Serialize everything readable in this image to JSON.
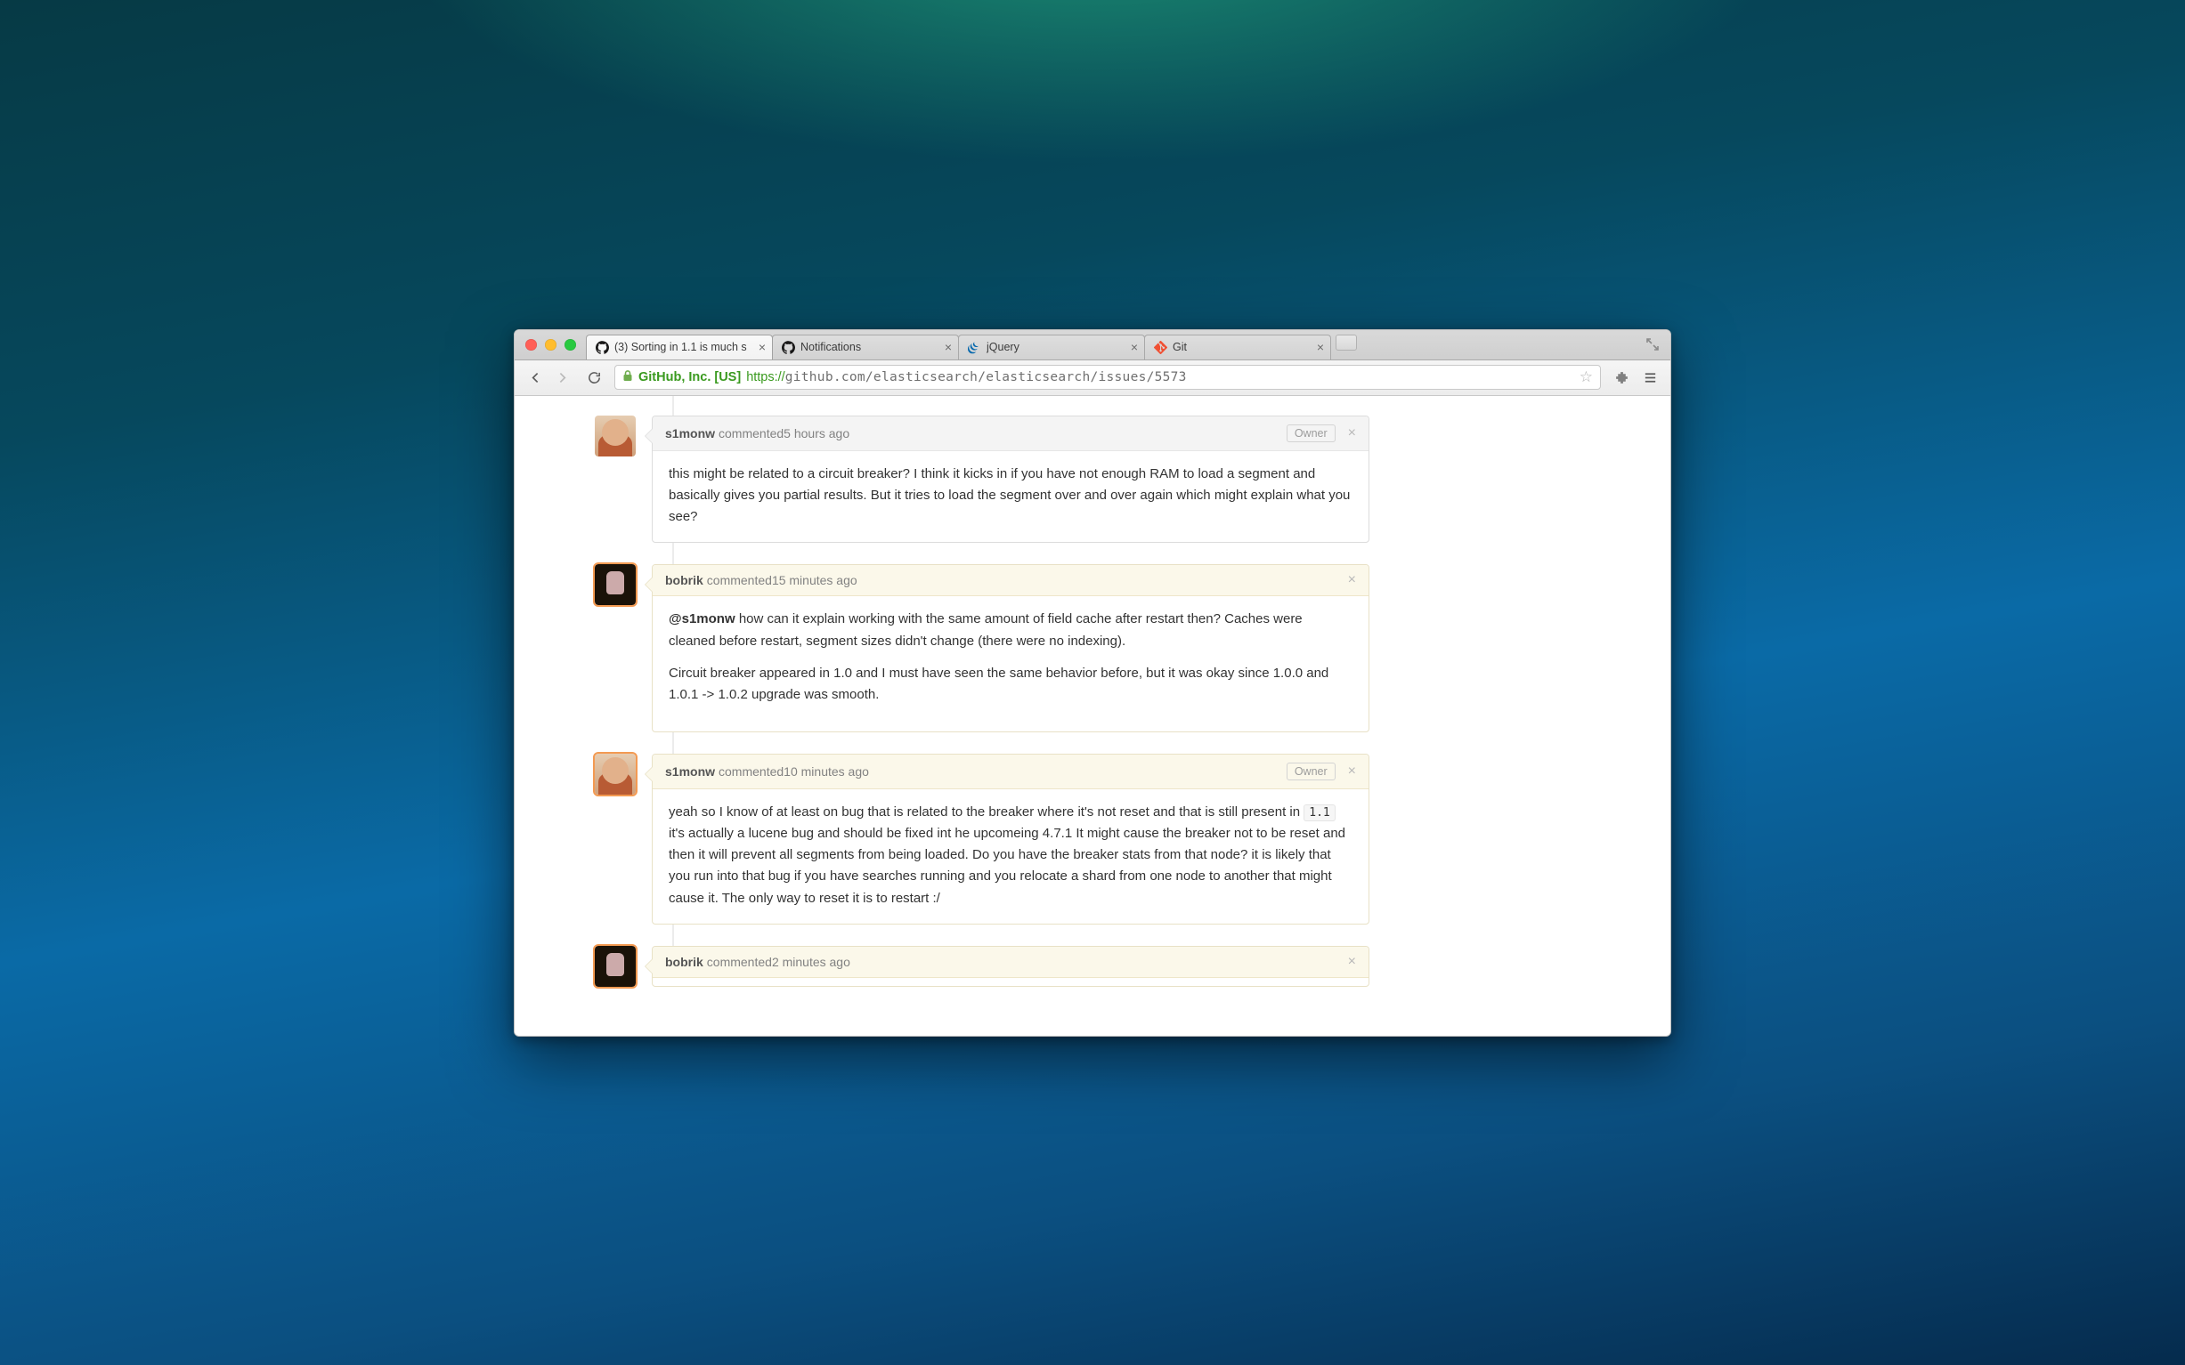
{
  "browser": {
    "tabs": [
      {
        "title": "(3) Sorting in 1.1 is much s",
        "kind": "github",
        "active": true
      },
      {
        "title": "Notifications",
        "kind": "github",
        "active": false
      },
      {
        "title": "jQuery",
        "kind": "jquery",
        "active": false
      },
      {
        "title": "Git",
        "kind": "git",
        "active": false
      }
    ],
    "url_ev_label": "GitHub, Inc. [US]",
    "url_proto": "https://",
    "url_rest": "github.com/elasticsearch/elasticsearch/issues/5573"
  },
  "strings": {
    "owner_badge": "Owner",
    "commented": "commented"
  },
  "comments": [
    {
      "author": "s1monw",
      "when": "5 hours ago",
      "owner": true,
      "self": false,
      "avatar": "s1",
      "body_html": "this might be related to a circuit breaker? I think it kicks in if you have not enough RAM to load a segment and basically gives you partial results. But it tries to load the segment over and over again which might explain what you see?"
    },
    {
      "author": "bobrik",
      "when": "15 minutes ago",
      "owner": false,
      "self": true,
      "avatar": "bo",
      "body_html": "<span class=\"mention\">@s1monw</span> how can it explain working with the same amount of field cache after restart then? Caches were cleaned before restart, segment sizes didn't change (there were no indexing).<p>Circuit breaker appeared in 1.0 and I must have seen the same behavior before, but it was okay since 1.0.0 and 1.0.1 -> 1.0.2 upgrade was smooth.</p>"
    },
    {
      "author": "s1monw",
      "when": "10 minutes ago",
      "owner": true,
      "self": true,
      "avatar": "s1",
      "body_html": "yeah so I know of at least on bug that is related to the breaker where it's not reset and that is still present in <code>1.1</code> it's actually a lucene bug and should be fixed int he upcomeing 4.7.1 It might cause the breaker not to be reset and then it will prevent all segments from being loaded. Do you have the breaker stats from that node? it is likely that you run into that bug if you have searches running and you relocate a shard from one node to another that might cause it. The only way to reset it is to restart :/"
    },
    {
      "author": "bobrik",
      "when": "2 minutes ago",
      "owner": false,
      "self": true,
      "avatar": "bo",
      "collapsed": true,
      "body_html": ""
    }
  ]
}
